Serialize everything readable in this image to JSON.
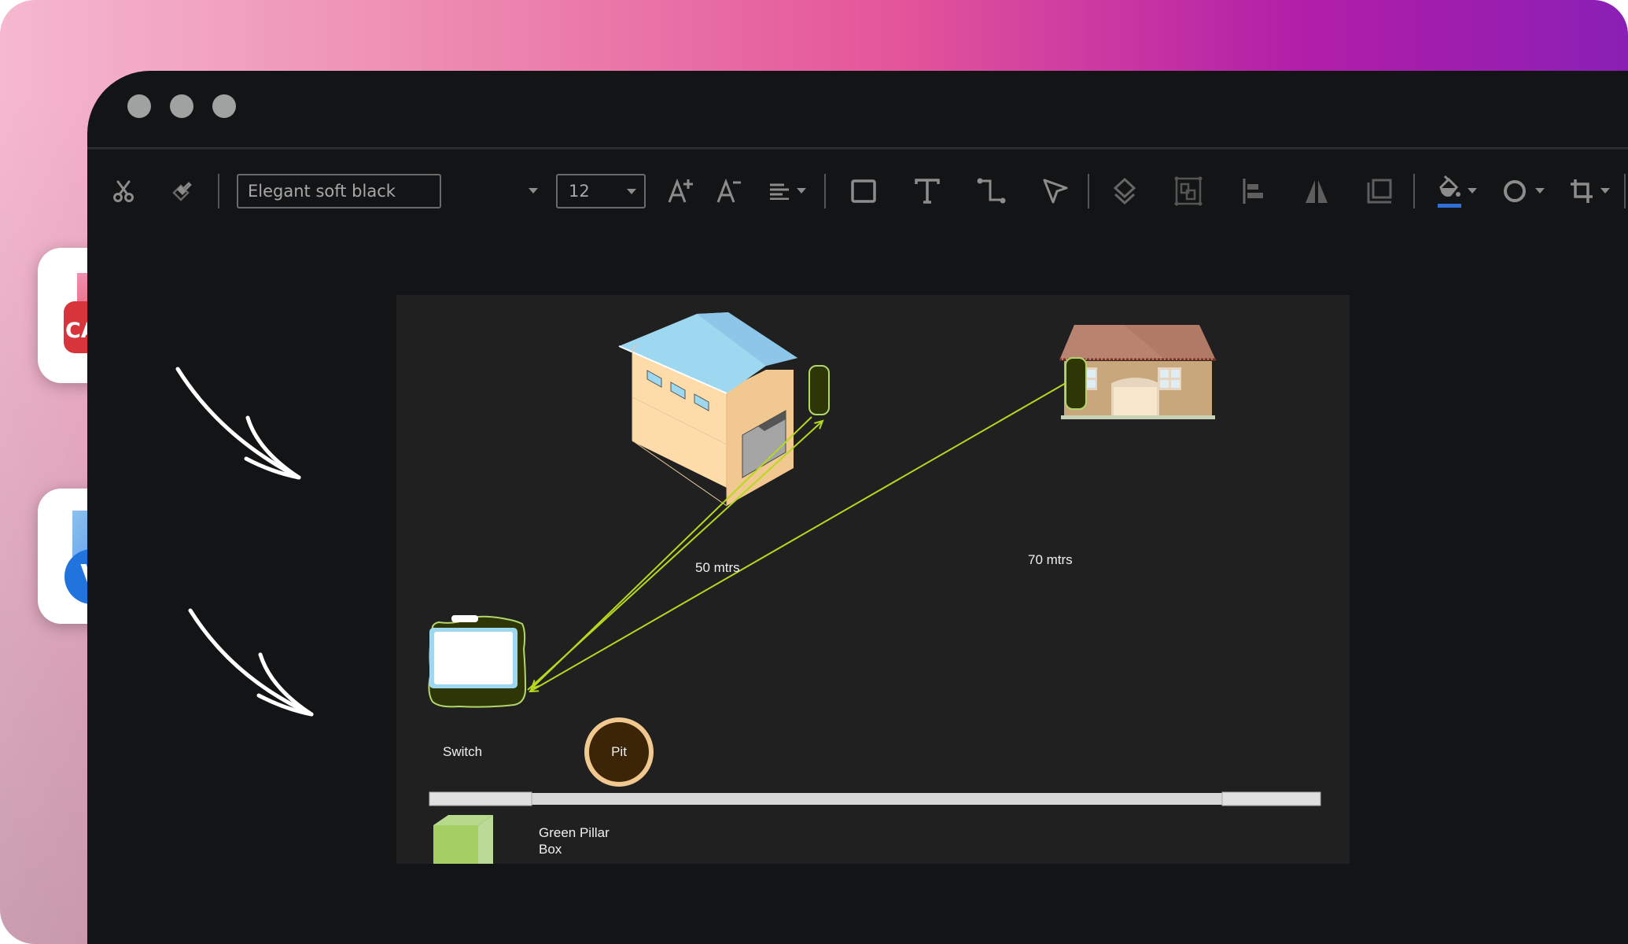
{
  "window": {
    "traffic_lights": [
      "close",
      "minimize",
      "maximize"
    ]
  },
  "toolbar": {
    "cut_icon": "scissors-icon",
    "format_painter_icon": "format-painter-icon",
    "font_name": "Elegant soft black",
    "font_size": "12",
    "increase_font_icon": "font-increase-icon",
    "decrease_font_icon": "font-decrease-icon",
    "align_icon": "align-left-icon",
    "rectangle_icon": "rectangle-icon",
    "text_icon": "text-icon",
    "connector_icon": "connector-icon",
    "pointer_icon": "pointer-icon",
    "layers_icon": "layers-icon",
    "group_icon": "group-icon",
    "align_objects_icon": "align-objects-icon",
    "flip_icon": "flip-icon",
    "frame_icon": "frame-icon",
    "fill_icon": "fill-bucket-icon",
    "fill_color": "#2f6fd6",
    "shape_style_icon": "shape-style-icon",
    "crop_icon": "crop-icon"
  },
  "side_apps": [
    {
      "name": "CAD",
      "label": "CAD",
      "color": "#e23b44"
    },
    {
      "name": "Visio",
      "label": "V",
      "color": "#2f7be6"
    }
  ],
  "diagram": {
    "labels": {
      "distance_warehouse": "50 mtrs",
      "distance_house": "70 mtrs",
      "switch": "Switch",
      "pit": "Pit",
      "pillar_box": "Green Pillar Box"
    },
    "connector_color": "#b5d91f",
    "shapes": [
      "warehouse",
      "house",
      "switch",
      "pit",
      "cable",
      "green-pillar-box"
    ]
  }
}
